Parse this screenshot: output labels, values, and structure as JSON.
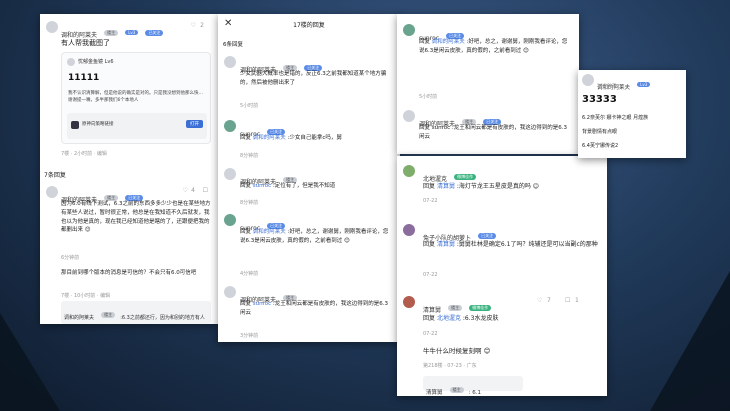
{
  "p1": {
    "top": {
      "user": "调和的阿莱夫",
      "badge1": "楼主",
      "badge2": "Lv3",
      "badge3": "已关注",
      "likes": "2",
      "text": "有人帮我截图了",
      "card_user": "忧郁金鱼镜 Lv6",
      "card_number": "11111",
      "card_body": "我不认识清算解，但是他说的确实是对的。只是我没想到他那么快…谢谢提一嘴，多半那我们6个本地人",
      "card_link": "原神向策略链接",
      "card_btn": "打开",
      "meta": "7楼 · 2小时前 · 编辑"
    },
    "section": "7条回复",
    "r1": {
      "user": "调和的阿莱夫",
      "badge1": "楼主",
      "badge2": "已关注",
      "likes": "4",
      "text": "因为6.0有线下测试，6.3之前的东西多多少少也是在某些地方有某些人说过，暂时很正常，他总是在我知道不久后就发，我也以为他是真的，现在我已经知道他是瞎的了，还跟便把我的都删出来 😊",
      "time": "6分钟前"
    },
    "r2": {
      "text": "那目前到哪个版本的消息是可信的？不会只有6.0可信吧",
      "meta": "7楼 · 10小时前 · 编辑",
      "quote_user": "调和的阿莱夫",
      "quote_badge": "楼主",
      "quote_text": ":6.3之前都还行，因为和别的地方有人说"
    },
    "footer_meta": "7楼 · 10小时前 · 编辑"
  },
  "p2": {
    "title": "17楼的回复",
    "section": "6条回复",
    "c1": {
      "user": "调和的阿莱夫",
      "badge1": "楼主",
      "badge2": "已关注",
      "text": "少女武器大概率也是错的，反正6.3之前我都知道某个地方骗的，然后被他删出来了",
      "meta": "5小时前"
    },
    "c2": {
      "user": "sunroc",
      "badge": "已关注",
      "text_prefix": "回复",
      "mention": "调和的阿莱夫",
      "text": ":少女自己能拿c吗，舅",
      "meta": "8分钟前"
    },
    "c3": {
      "user": "调和的阿莱夫",
      "badge": "楼主",
      "text_prefix": "回复",
      "mention": "sunroc",
      "text": ":定位有了，但是我不知道",
      "meta": "8分钟前"
    },
    "c4": {
      "user": "sunroc",
      "badge": "已关注",
      "text_prefix": "回复",
      "mention": "调和的阿莱夫",
      "text": ":好吧，总之，谢谢舅，刚刚我看评论，您说6.3是闲云皮肤，真的假的，之前看到过 😊",
      "meta": "4分钟前"
    },
    "c5": {
      "user": "调和的阿莱夫",
      "badge": "楼主",
      "text_prefix": "回复",
      "mention": "sunroc",
      "text": ":龙王和闲云都是有皮肤的，我这边得到的是6.3闲云",
      "meta": "3分钟前"
    }
  },
  "p3": {
    "c1": {
      "user": "sunroc",
      "badge": "已关注",
      "text_prefix": "回复",
      "mention": "调和的阿莱夫",
      "text": ":好吧，总之，谢谢舅，刚刚我看评论，您说6.3是闲云皮肤，真的假的，之前看到过 😊",
      "meta": "5小时前"
    },
    "c2": {
      "user": "调和的阿莱夫",
      "badge1": "楼主",
      "badge2": "已关注",
      "text": "回复 sunroc :龙王和闲云都是有皮肤的，我这边得到的是6.3闲云",
      "meta": "4小时前"
    }
  },
  "p4": {
    "c1": {
      "user": "北地渥克",
      "badge": "微博佳作",
      "text_prefix": "回复",
      "mention": "清算舅",
      "text": ":海灯节龙王五星皮是真的吗 😊",
      "date": "07-22"
    },
    "c2": {
      "user": "兔子小队的胡萝卜",
      "badge": "已关注",
      "text_prefix": "回复",
      "mention": "清算舅",
      "text": ":舅舅杜林是确定6.1了吗？纯辅还是可以当副c的那种",
      "date": "07-22"
    },
    "c3": {
      "user": "清算舅",
      "badge1": "楼主",
      "badge2": "微博佳作",
      "likes": "7",
      "comments": "1",
      "text_prefix": "回复",
      "mention": "北地渥克",
      "text": ":6.3水龙皮肤",
      "date": "07-22"
    },
    "c4": {
      "text": "牛牛什么时候复刻啊 😊",
      "meta": "第218楼 · 07-23 · 广东",
      "reply_user": "清算舅",
      "reply_badge": "楼主",
      "reply_text": ": 6.1"
    }
  },
  "p5": {
    "user": "调和的阿莱夫",
    "badge": "Lv3",
    "meta": "16分钟前",
    "number": "33333",
    "lines": [
      "6.2奈芙尔 娜卡神之眼 月煌族",
      "背景剧情有点眼",
      "6.4芙宁娜传说2"
    ]
  }
}
